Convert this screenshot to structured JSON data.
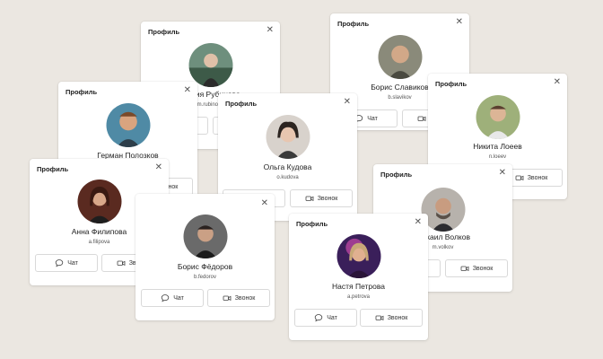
{
  "dialog_title": "Профиль",
  "close_glyph": "✕",
  "chat_label": "Чат",
  "call_label": "Звонок",
  "profiles": {
    "maria": {
      "name": "Мария Рубинова",
      "login": "m.rubinova"
    },
    "boris_s": {
      "name": "Борис Славиков",
      "login": "b.slavikov"
    },
    "german": {
      "name": "Герман Полозков",
      "login": "g.polozkov"
    },
    "olga": {
      "name": "Ольга Кудова",
      "login": "o.kudova"
    },
    "nikita": {
      "name": "Никита Лоеев",
      "login": "n.loeev"
    },
    "anna": {
      "name": "Анна Филипова",
      "login": "a.filipova"
    },
    "mikhail": {
      "name": "Михаил Волков",
      "login": "m.volkov"
    },
    "boris_f": {
      "name": "Борис Фёдоров",
      "login": "b.fedorov"
    },
    "nastya": {
      "name": "Настя Петрова",
      "login": "a.petrova"
    }
  },
  "icons": {
    "chat": "chat-bubble-icon",
    "call": "video-camera-icon",
    "close": "close-icon"
  },
  "colors": {
    "background": "#ebe7e1",
    "card": "#ffffff",
    "border": "#d9d9d9"
  }
}
